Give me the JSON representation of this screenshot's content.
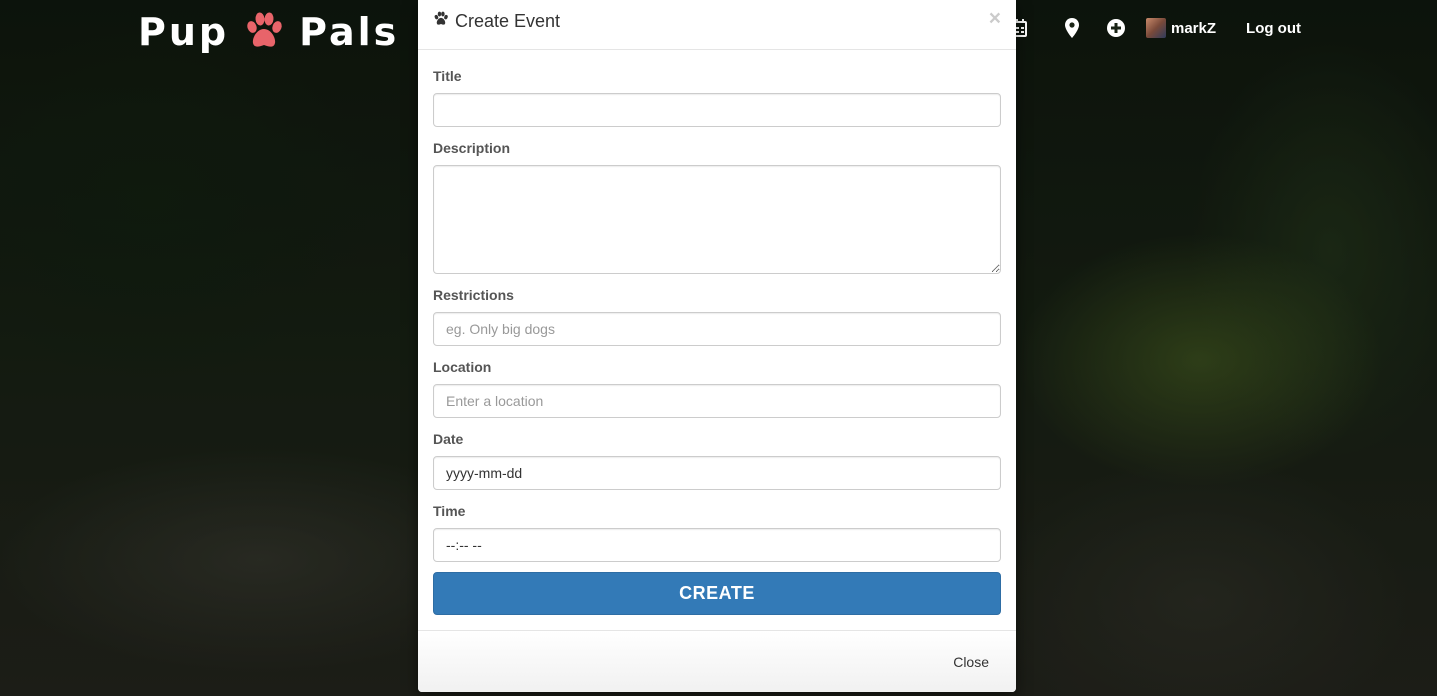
{
  "brand": {
    "left": "Pup",
    "right": "Pals",
    "paw_color": "#e8646a"
  },
  "nav": {
    "icons": [
      "calendar-icon",
      "map-marker-icon",
      "plus-circle-icon"
    ],
    "username": "markZ",
    "logout_label": "Log out"
  },
  "modal": {
    "title": "Create Event",
    "close_x": "×",
    "fields": {
      "title": {
        "label": "Title",
        "value": "",
        "placeholder": ""
      },
      "description": {
        "label": "Description",
        "value": "",
        "placeholder": ""
      },
      "restrictions": {
        "label": "Restrictions",
        "value": "",
        "placeholder": "eg. Only big dogs"
      },
      "location": {
        "label": "Location",
        "value": "",
        "placeholder": "Enter a location"
      },
      "date": {
        "label": "Date",
        "value": "yyyy-mm-dd"
      },
      "time": {
        "label": "Time",
        "value": "--:-- --"
      }
    },
    "create_label": "CREATE",
    "close_label": "Close"
  },
  "colors": {
    "primary": "#337ab7",
    "accent": "#e8646a"
  }
}
